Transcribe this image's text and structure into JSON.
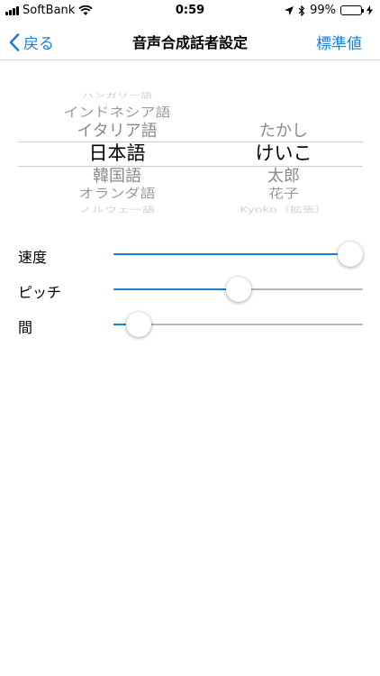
{
  "status_bar": {
    "carrier": "SoftBank",
    "time": "0:59",
    "battery": "99%",
    "battery_level": 0.99,
    "icons": [
      "signal-icon",
      "wifi-icon",
      "location-icon",
      "bluetooth-icon",
      "battery-icon",
      "charging-icon"
    ]
  },
  "nav": {
    "back_label": "戻る",
    "title": "音声合成話者設定",
    "reset_label": "標準値"
  },
  "picker": {
    "languages": [
      "ハンガリー語",
      "インドネシア語",
      "イタリア語",
      "日本語",
      "韓国語",
      "オランダ語",
      "ノルウェー語"
    ],
    "selected_language": "日本語",
    "voices": [
      "たかし",
      "けいこ",
      "太郎",
      "花子",
      "Kyoko（拡張）"
    ],
    "selected_voice": "けいこ"
  },
  "sliders": [
    {
      "label": "速度",
      "value": 1.0
    },
    {
      "label": "ピッチ",
      "value": 0.5
    },
    {
      "label": "間",
      "value": 0.05
    }
  ],
  "colors": {
    "accent": "#1a7fdb",
    "track": "#b6b6b6",
    "battery": "#4cd964"
  }
}
